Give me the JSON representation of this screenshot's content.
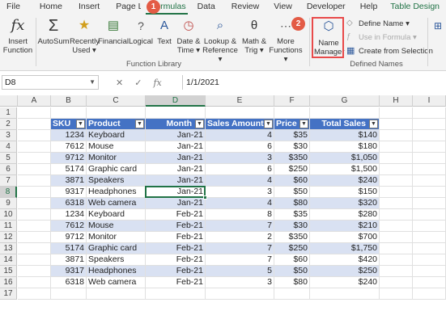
{
  "menu": [
    "File",
    "Home",
    "Insert",
    "Page Layout",
    "Formulas",
    "Data",
    "Review",
    "View",
    "Developer",
    "Help",
    "Table Design"
  ],
  "ribbon": {
    "insert_function": [
      "Insert",
      "Function"
    ],
    "autosum": [
      "AutoSum",
      ""
    ],
    "recently_used": [
      "Recently",
      "Used ▾"
    ],
    "financial": [
      "Financial",
      ""
    ],
    "logical": [
      "Logical",
      ""
    ],
    "text": [
      "Text",
      ""
    ],
    "date_time": [
      "Date &",
      "Time ▾"
    ],
    "lookup": [
      "Lookup &",
      "Reference ▾"
    ],
    "math": [
      "Math &",
      "Trig ▾"
    ],
    "more": [
      "More",
      "Functions ▾"
    ],
    "function_library_label": "Function Library",
    "name_manager": [
      "Name",
      "Manager"
    ],
    "define_name": "Define Name ▾",
    "use_in_formula": "Use in Formula ▾",
    "create_from_selection": "Create from Selection",
    "defined_names_label": "Defined Names",
    "badge1": "1",
    "badge2": "2"
  },
  "formula_bar": {
    "name_box": "D8",
    "cancel": "✕",
    "enter": "✓",
    "fx": "fx",
    "value": "1/1/2021"
  },
  "columns": [
    "A",
    "B",
    "C",
    "D",
    "E",
    "F",
    "G",
    "H",
    "I"
  ],
  "rows": [
    "1",
    "2",
    "3",
    "4",
    "5",
    "6",
    "7",
    "8",
    "9",
    "10",
    "11",
    "12",
    "13",
    "14",
    "15",
    "16",
    "17"
  ],
  "table": {
    "headers": [
      "SKU",
      "Product",
      "Month",
      "Sales Amount",
      "Price",
      "Total Sales"
    ],
    "data": [
      [
        "1234",
        "Keyboard",
        "Jan-21",
        "4",
        "$35",
        "$140"
      ],
      [
        "7612",
        "Mouse",
        "Jan-21",
        "6",
        "$30",
        "$180"
      ],
      [
        "9712",
        "Monitor",
        "Jan-21",
        "3",
        "$350",
        "$1,050"
      ],
      [
        "5174",
        "Graphic card",
        "Jan-21",
        "6",
        "$250",
        "$1,500"
      ],
      [
        "3871",
        "Speakers",
        "Jan-21",
        "4",
        "$60",
        "$240"
      ],
      [
        "9317",
        "Headphones",
        "Jan-21",
        "3",
        "$50",
        "$150"
      ],
      [
        "6318",
        "Web camera",
        "Jan-21",
        "4",
        "$80",
        "$320"
      ],
      [
        "1234",
        "Keyboard",
        "Feb-21",
        "8",
        "$35",
        "$280"
      ],
      [
        "7612",
        "Mouse",
        "Feb-21",
        "7",
        "$30",
        "$210"
      ],
      [
        "9712",
        "Monitor",
        "Feb-21",
        "2",
        "$350",
        "$700"
      ],
      [
        "5174",
        "Graphic card",
        "Feb-21",
        "7",
        "$250",
        "$1,750"
      ],
      [
        "3871",
        "Speakers",
        "Feb-21",
        "7",
        "$60",
        "$420"
      ],
      [
        "9317",
        "Headphones",
        "Feb-21",
        "5",
        "$50",
        "$250"
      ],
      [
        "6318",
        "Web camera",
        "Feb-21",
        "3",
        "$80",
        "$240"
      ]
    ]
  },
  "colors": {
    "accent": "#217346",
    "header_fill": "#4472c4",
    "band_fill": "#d9e1f2",
    "highlight": "#e84a4a"
  }
}
